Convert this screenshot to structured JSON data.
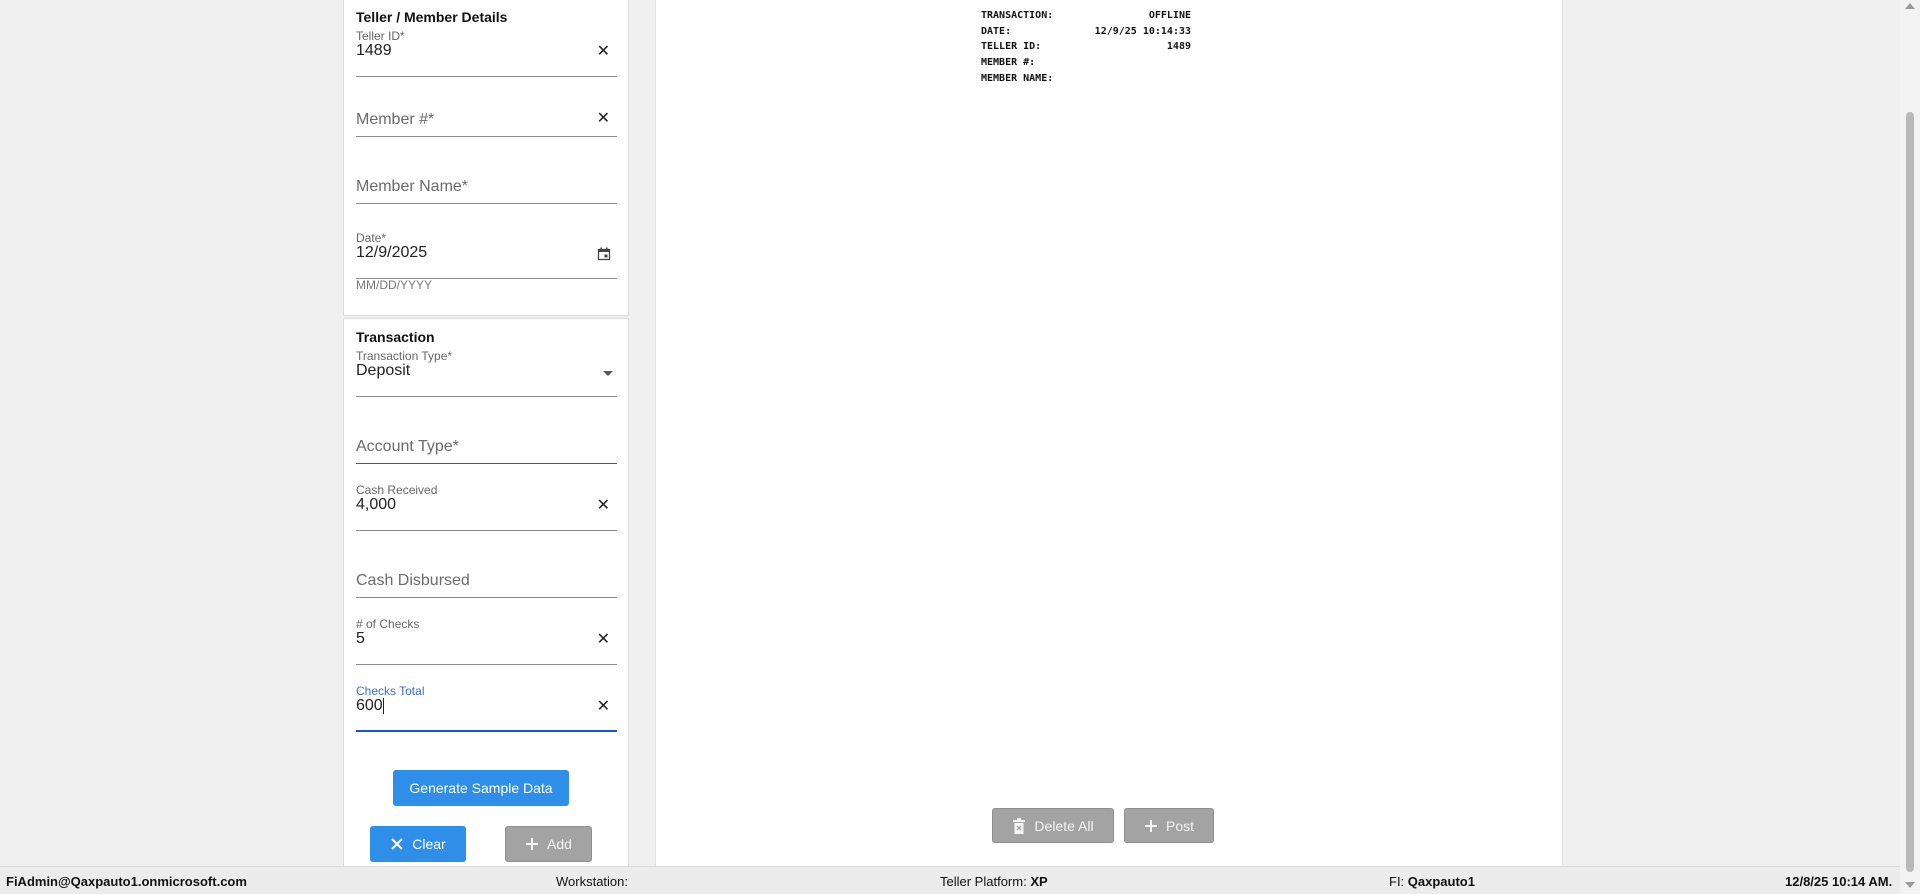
{
  "member_details": {
    "title": "Teller / Member Details",
    "teller_id": {
      "label": "Teller ID*",
      "value": "1489"
    },
    "member_number": {
      "placeholder": "Member #*"
    },
    "member_name": {
      "placeholder": "Member Name*"
    },
    "date": {
      "label": "Date*",
      "value": "12/9/2025",
      "hint": "MM/DD/YYYY"
    }
  },
  "transaction": {
    "title": "Transaction",
    "transaction_type": {
      "label": "Transaction Type*",
      "value": "Deposit"
    },
    "account_type": {
      "placeholder": "Account Type*"
    },
    "cash_received": {
      "label": "Cash Received",
      "value": "4,000"
    },
    "cash_disbursed": {
      "placeholder": "Cash Disbursed"
    },
    "num_checks": {
      "label": "# of Checks",
      "value": "5"
    },
    "checks_total": {
      "label": "Checks Total",
      "value": "600"
    }
  },
  "buttons": {
    "generate_sample": "Generate Sample Data",
    "clear": "Clear",
    "add": "Add",
    "delete_all": "Delete All",
    "post": "Post"
  },
  "receipt": {
    "rows": [
      {
        "label": "TRANSACTION:",
        "value": "OFFLINE"
      },
      {
        "label": "DATE:",
        "value": "12/9/25 10:14:33"
      },
      {
        "label": "TELLER ID:",
        "value": "1489"
      },
      {
        "label": "MEMBER #:",
        "value": ""
      },
      {
        "label": "MEMBER NAME:",
        "value": ""
      }
    ]
  },
  "status_bar": {
    "user": "FiAdmin@Qaxpauto1.onmicrosoft.com",
    "workstation_label": "Workstation:",
    "workstation_value": "",
    "platform_label": "Teller Platform: ",
    "platform_value": "XP",
    "fi_label": "FI: ",
    "fi_value": "Qaxpauto1",
    "datetime": "12/8/25 10:14 AM."
  }
}
